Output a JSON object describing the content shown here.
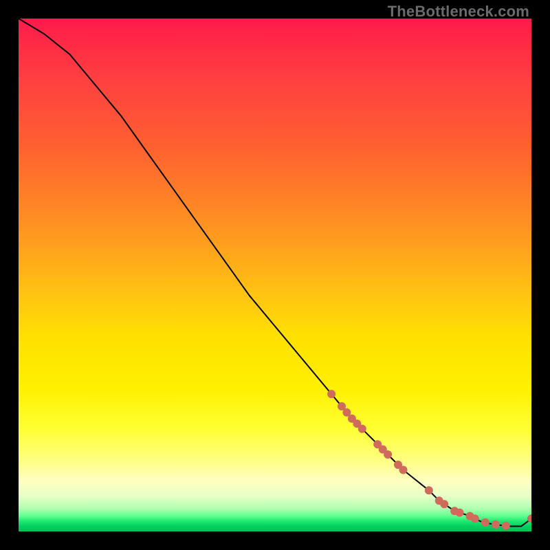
{
  "watermark": "TheBottleneck.com",
  "chart_data": {
    "type": "line",
    "title": "",
    "xlabel": "",
    "ylabel": "",
    "xlim": [
      0,
      100
    ],
    "ylim": [
      0,
      100
    ],
    "series": [
      {
        "name": "curve",
        "x": [
          0,
          5,
          10,
          15,
          20,
          25,
          30,
          35,
          40,
          45,
          50,
          55,
          60,
          65,
          70,
          75,
          80,
          82,
          85,
          88,
          90,
          92,
          94,
          96,
          98,
          100
        ],
        "y": [
          100,
          97,
          93,
          87,
          81,
          74,
          67,
          60,
          53,
          46,
          40,
          34,
          28,
          22,
          17,
          12,
          8,
          6,
          4,
          3,
          2,
          1.5,
          1.2,
          1.0,
          1.0,
          2.5
        ]
      }
    ],
    "markers": {
      "series": "curve",
      "x": [
        61,
        63,
        64,
        65,
        66,
        67,
        70,
        71,
        72,
        74,
        75,
        80,
        82,
        83,
        85,
        86,
        88,
        89,
        91,
        93,
        95,
        100
      ]
    },
    "marker_color": "#cf6a5d",
    "curve_color": "#000000",
    "background": "rainbow-heat-gradient"
  }
}
